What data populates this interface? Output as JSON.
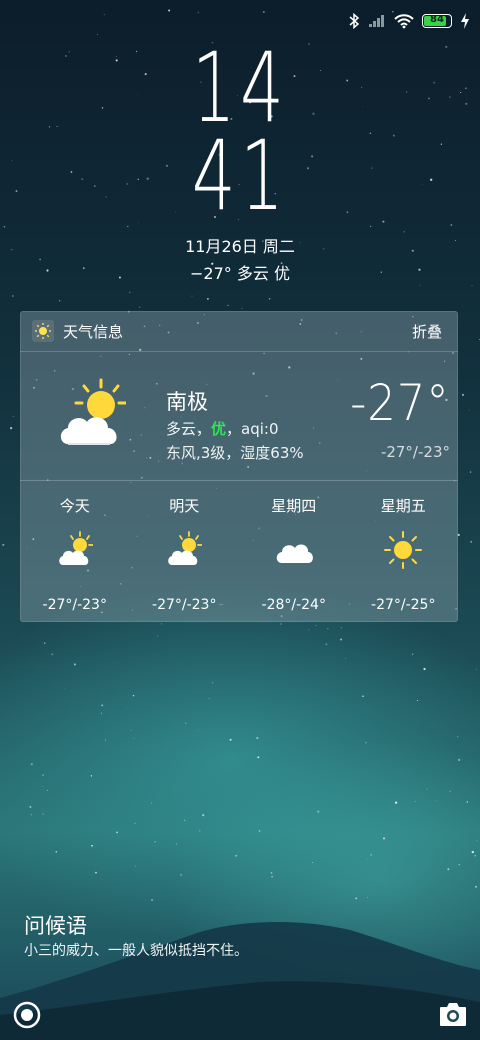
{
  "status": {
    "battery": "84"
  },
  "clock": {
    "hour": "14",
    "minute": "41"
  },
  "lock": {
    "date": "11月26日 周二",
    "weather": "−27° 多云 优"
  },
  "card": {
    "title": "天气信息",
    "fold": "折叠",
    "city": "南极",
    "desc_prefix": "多云，",
    "aqi_quality": "优",
    "aqi_suffix": "，aqi:0",
    "wind": "东风,3级，湿度63%",
    "temp": "-27°",
    "range": "-27°/-23°",
    "forecast": [
      {
        "day": "今天",
        "range": "-27°/-23°",
        "icon": "partly-cloudy"
      },
      {
        "day": "明天",
        "range": "-27°/-23°",
        "icon": "partly-cloudy"
      },
      {
        "day": "星期四",
        "range": "-28°/-24°",
        "icon": "cloud"
      },
      {
        "day": "星期五",
        "range": "-27°/-25°",
        "icon": "sun"
      }
    ]
  },
  "greeting": {
    "title": "问候语",
    "text": "小三的威力、一般人貌似抵挡不住。"
  },
  "colors": {
    "aqi_good": "#33e05a",
    "battery_fill": "#37d14b"
  }
}
